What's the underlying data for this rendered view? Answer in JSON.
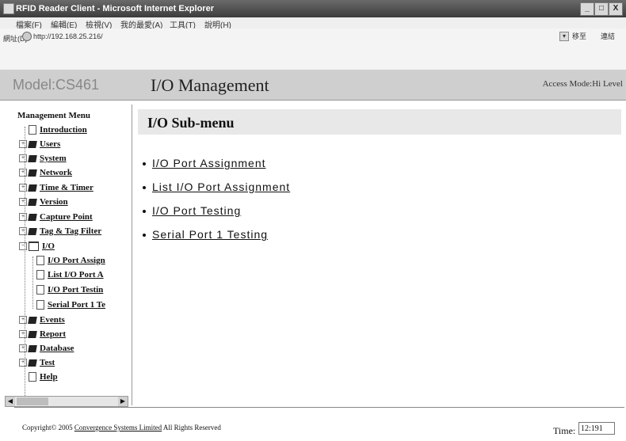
{
  "window": {
    "title": "RFID Reader Client - Microsoft Internet Explorer",
    "minimize": "_",
    "maximize": "□",
    "close": "X"
  },
  "menubar": [
    "檔案(F)",
    "編輯(E)",
    "檢視(V)",
    "我的最愛(A)",
    "工具(T)",
    "說明(H)"
  ],
  "address": {
    "label": "網址(D)",
    "url": "http://192.168.25.216/",
    "go_label": "移至",
    "links_label": "連結"
  },
  "header": {
    "model": "Model:CS461",
    "page_title": "I/O Management",
    "access_mode": "Access Mode:Hi Level"
  },
  "sidebar": {
    "title": "Management Menu",
    "items": [
      {
        "label": "Introduction",
        "icon": "doc-icon"
      },
      {
        "label": "Users",
        "icon": "book-icon"
      },
      {
        "label": "System",
        "icon": "book-icon"
      },
      {
        "label": "Network",
        "icon": "book-icon"
      },
      {
        "label": "Time & Timer",
        "icon": "book-icon"
      },
      {
        "label": "Version",
        "icon": "book-icon"
      },
      {
        "label": "Capture Point",
        "icon": "book-icon"
      },
      {
        "label": "Tag & Tag Filter",
        "icon": "book-icon"
      },
      {
        "label": "I/O",
        "icon": "open-folder-icon"
      },
      {
        "label": "I/O Port Assign",
        "icon": "doc-icon"
      },
      {
        "label": "List I/O Port A",
        "icon": "doc-icon"
      },
      {
        "label": "I/O Port Testin",
        "icon": "doc-icon"
      },
      {
        "label": "Serial Port 1 Te",
        "icon": "doc-icon"
      },
      {
        "label": "Events",
        "icon": "book-icon"
      },
      {
        "label": "Report",
        "icon": "book-icon"
      },
      {
        "label": "Database",
        "icon": "book-icon"
      },
      {
        "label": "Test",
        "icon": "book-icon"
      },
      {
        "label": "Help",
        "icon": "doc-icon"
      }
    ]
  },
  "main": {
    "submenu_title": "I/O Sub-menu",
    "links": [
      "I/O Port Assignment",
      "List I/O Port Assignment",
      "I/O Port Testing",
      "Serial Port 1 Testing"
    ]
  },
  "footer": {
    "copyright_prefix": "Copyright© 2005 ",
    "company": "Convergence Systems Limited",
    "copyright_suffix": " All Rights Reserved",
    "time_label": "Time:",
    "time_value": "12:191"
  }
}
